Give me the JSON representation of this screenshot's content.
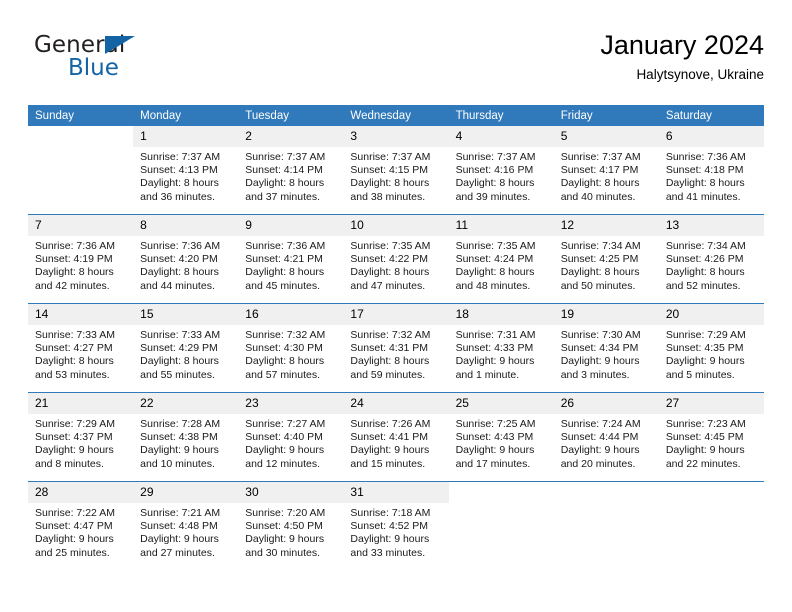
{
  "brand": {
    "name_part1": "General",
    "name_part2": "Blue",
    "triangle_color": "#1464a5"
  },
  "header": {
    "title": "January 2024",
    "subtitle": "Halytsynove, Ukraine"
  },
  "theme": {
    "header_bar_color": "#3079ba",
    "daynum_band_color": "#f0f0f0",
    "week_separator_color": "#3079ba"
  },
  "weekday_headers": [
    "Sunday",
    "Monday",
    "Tuesday",
    "Wednesday",
    "Thursday",
    "Friday",
    "Saturday"
  ],
  "weeks": [
    [
      {
        "day": "",
        "lines": []
      },
      {
        "day": "1",
        "lines": [
          "Sunrise: 7:37 AM",
          "Sunset: 4:13 PM",
          "Daylight: 8 hours",
          "and 36 minutes."
        ]
      },
      {
        "day": "2",
        "lines": [
          "Sunrise: 7:37 AM",
          "Sunset: 4:14 PM",
          "Daylight: 8 hours",
          "and 37 minutes."
        ]
      },
      {
        "day": "3",
        "lines": [
          "Sunrise: 7:37 AM",
          "Sunset: 4:15 PM",
          "Daylight: 8 hours",
          "and 38 minutes."
        ]
      },
      {
        "day": "4",
        "lines": [
          "Sunrise: 7:37 AM",
          "Sunset: 4:16 PM",
          "Daylight: 8 hours",
          "and 39 minutes."
        ]
      },
      {
        "day": "5",
        "lines": [
          "Sunrise: 7:37 AM",
          "Sunset: 4:17 PM",
          "Daylight: 8 hours",
          "and 40 minutes."
        ]
      },
      {
        "day": "6",
        "lines": [
          "Sunrise: 7:36 AM",
          "Sunset: 4:18 PM",
          "Daylight: 8 hours",
          "and 41 minutes."
        ]
      }
    ],
    [
      {
        "day": "7",
        "lines": [
          "Sunrise: 7:36 AM",
          "Sunset: 4:19 PM",
          "Daylight: 8 hours",
          "and 42 minutes."
        ]
      },
      {
        "day": "8",
        "lines": [
          "Sunrise: 7:36 AM",
          "Sunset: 4:20 PM",
          "Daylight: 8 hours",
          "and 44 minutes."
        ]
      },
      {
        "day": "9",
        "lines": [
          "Sunrise: 7:36 AM",
          "Sunset: 4:21 PM",
          "Daylight: 8 hours",
          "and 45 minutes."
        ]
      },
      {
        "day": "10",
        "lines": [
          "Sunrise: 7:35 AM",
          "Sunset: 4:22 PM",
          "Daylight: 8 hours",
          "and 47 minutes."
        ]
      },
      {
        "day": "11",
        "lines": [
          "Sunrise: 7:35 AM",
          "Sunset: 4:24 PM",
          "Daylight: 8 hours",
          "and 48 minutes."
        ]
      },
      {
        "day": "12",
        "lines": [
          "Sunrise: 7:34 AM",
          "Sunset: 4:25 PM",
          "Daylight: 8 hours",
          "and 50 minutes."
        ]
      },
      {
        "day": "13",
        "lines": [
          "Sunrise: 7:34 AM",
          "Sunset: 4:26 PM",
          "Daylight: 8 hours",
          "and 52 minutes."
        ]
      }
    ],
    [
      {
        "day": "14",
        "lines": [
          "Sunrise: 7:33 AM",
          "Sunset: 4:27 PM",
          "Daylight: 8 hours",
          "and 53 minutes."
        ]
      },
      {
        "day": "15",
        "lines": [
          "Sunrise: 7:33 AM",
          "Sunset: 4:29 PM",
          "Daylight: 8 hours",
          "and 55 minutes."
        ]
      },
      {
        "day": "16",
        "lines": [
          "Sunrise: 7:32 AM",
          "Sunset: 4:30 PM",
          "Daylight: 8 hours",
          "and 57 minutes."
        ]
      },
      {
        "day": "17",
        "lines": [
          "Sunrise: 7:32 AM",
          "Sunset: 4:31 PM",
          "Daylight: 8 hours",
          "and 59 minutes."
        ]
      },
      {
        "day": "18",
        "lines": [
          "Sunrise: 7:31 AM",
          "Sunset: 4:33 PM",
          "Daylight: 9 hours",
          "and 1 minute."
        ]
      },
      {
        "day": "19",
        "lines": [
          "Sunrise: 7:30 AM",
          "Sunset: 4:34 PM",
          "Daylight: 9 hours",
          "and 3 minutes."
        ]
      },
      {
        "day": "20",
        "lines": [
          "Sunrise: 7:29 AM",
          "Sunset: 4:35 PM",
          "Daylight: 9 hours",
          "and 5 minutes."
        ]
      }
    ],
    [
      {
        "day": "21",
        "lines": [
          "Sunrise: 7:29 AM",
          "Sunset: 4:37 PM",
          "Daylight: 9 hours",
          "and 8 minutes."
        ]
      },
      {
        "day": "22",
        "lines": [
          "Sunrise: 7:28 AM",
          "Sunset: 4:38 PM",
          "Daylight: 9 hours",
          "and 10 minutes."
        ]
      },
      {
        "day": "23",
        "lines": [
          "Sunrise: 7:27 AM",
          "Sunset: 4:40 PM",
          "Daylight: 9 hours",
          "and 12 minutes."
        ]
      },
      {
        "day": "24",
        "lines": [
          "Sunrise: 7:26 AM",
          "Sunset: 4:41 PM",
          "Daylight: 9 hours",
          "and 15 minutes."
        ]
      },
      {
        "day": "25",
        "lines": [
          "Sunrise: 7:25 AM",
          "Sunset: 4:43 PM",
          "Daylight: 9 hours",
          "and 17 minutes."
        ]
      },
      {
        "day": "26",
        "lines": [
          "Sunrise: 7:24 AM",
          "Sunset: 4:44 PM",
          "Daylight: 9 hours",
          "and 20 minutes."
        ]
      },
      {
        "day": "27",
        "lines": [
          "Sunrise: 7:23 AM",
          "Sunset: 4:45 PM",
          "Daylight: 9 hours",
          "and 22 minutes."
        ]
      }
    ],
    [
      {
        "day": "28",
        "lines": [
          "Sunrise: 7:22 AM",
          "Sunset: 4:47 PM",
          "Daylight: 9 hours",
          "and 25 minutes."
        ]
      },
      {
        "day": "29",
        "lines": [
          "Sunrise: 7:21 AM",
          "Sunset: 4:48 PM",
          "Daylight: 9 hours",
          "and 27 minutes."
        ]
      },
      {
        "day": "30",
        "lines": [
          "Sunrise: 7:20 AM",
          "Sunset: 4:50 PM",
          "Daylight: 9 hours",
          "and 30 minutes."
        ]
      },
      {
        "day": "31",
        "lines": [
          "Sunrise: 7:18 AM",
          "Sunset: 4:52 PM",
          "Daylight: 9 hours",
          "and 33 minutes."
        ]
      },
      {
        "day": "",
        "lines": []
      },
      {
        "day": "",
        "lines": []
      },
      {
        "day": "",
        "lines": []
      }
    ]
  ]
}
